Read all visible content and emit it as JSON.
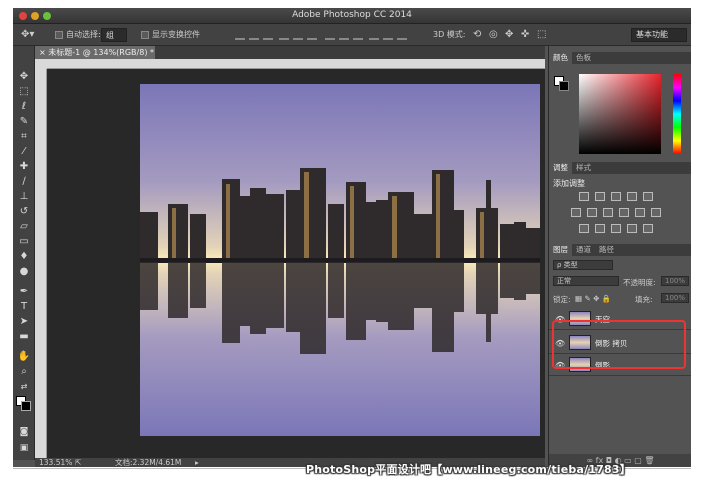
{
  "window": {
    "title": "Adobe Photoshop CC 2014"
  },
  "options_bar": {
    "auto_select_label": "自动选择:",
    "auto_select_value": "组",
    "show_transform_label": "显示变换控件",
    "mode_3d_label": "3D 模式:",
    "workspace": "基本功能"
  },
  "document": {
    "tab_title": "未标题-1 @ 134%(RGB/8) *"
  },
  "status_bar": {
    "zoom": "133.51%",
    "doc_size": "文档:2.32M/4.61M"
  },
  "panels": {
    "color_tabs": [
      "颜色",
      "色板"
    ],
    "adjust_tabs": [
      "调整",
      "样式"
    ],
    "adjust_title": "添加调整",
    "layers_tabs": [
      "图层",
      "通道",
      "路径"
    ],
    "filter_kind": "ρ 类型",
    "blend_mode": "正常",
    "opacity_label": "不透明度:",
    "opacity_value": "100%",
    "lock_label": "锁定:",
    "fill_label": "填充:",
    "fill_value": "100%"
  },
  "layers": [
    {
      "name": "天空",
      "visible": true
    },
    {
      "name": "倒影 拷贝",
      "visible": true
    },
    {
      "name": "倒影",
      "visible": true
    }
  ],
  "highlight_color": "#e33333",
  "watermark": "PhotoShop平面设计吧【www.lineeg.com/tieba/1783】"
}
